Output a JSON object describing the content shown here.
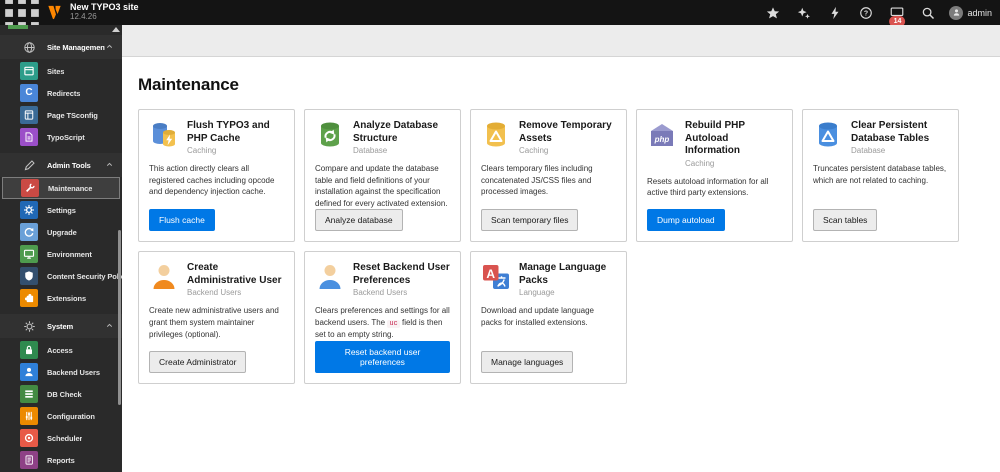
{
  "colors": {
    "primary_button": "#0078e6",
    "badge": "#d9534f",
    "topbar_bg": "#141414",
    "sidebar_bg": "#2a2a2a",
    "scrolled_module_sliver": "#4e9b4e"
  },
  "topbar": {
    "site_title": "New TYPO3 site",
    "version": "12.4.26",
    "badge_count": "14",
    "username": "admin",
    "icons": [
      "module-menu-toggle-icon",
      "typo3-logo",
      "bookmark-icon",
      "shortcut-icon",
      "clear-cache-icon",
      "help-icon",
      "system-information-icon",
      "search-icon",
      "avatar"
    ]
  },
  "sidebar": {
    "sections": [
      {
        "label": "Site Management",
        "icon": "globe-icon",
        "items": [
          {
            "label": "Sites",
            "icon": "sites-icon",
            "icon_color": "#2d9d8a"
          },
          {
            "label": "Redirects",
            "icon": "redirects-icon",
            "icon_color": "#4a86d8",
            "glyph": "C"
          },
          {
            "label": "Page TSconfig",
            "icon": "page-tsconfig-icon",
            "icon_color": "#3a6a96"
          },
          {
            "label": "TypoScript",
            "icon": "typoscript-icon",
            "icon_color": "#9b4fc8"
          }
        ]
      },
      {
        "label": "Admin Tools",
        "icon": "tools-icon",
        "items": [
          {
            "label": "Maintenance",
            "icon": "wrench-icon",
            "icon_color": "#ca4a44",
            "active": true
          },
          {
            "label": "Settings",
            "icon": "gear-icon",
            "icon_color": "#2068b5"
          },
          {
            "label": "Upgrade",
            "icon": "refresh-icon",
            "icon_color": "#6aa0d8"
          },
          {
            "label": "Environment",
            "icon": "monitor-icon",
            "icon_color": "#4e9b4e"
          },
          {
            "label": "Content Security Policy",
            "icon": "shield-icon",
            "icon_color": "#334f6e"
          },
          {
            "label": "Extensions",
            "icon": "puzzle-icon",
            "icon_color": "#ec8a00"
          }
        ]
      },
      {
        "label": "System",
        "icon": "gear-icon",
        "items": [
          {
            "label": "Access",
            "icon": "lock-icon",
            "icon_color": "#2f8a4f"
          },
          {
            "label": "Backend Users",
            "icon": "user-icon",
            "icon_color": "#2f80d9"
          },
          {
            "label": "DB Check",
            "icon": "db-icon",
            "icon_color": "#438a43"
          },
          {
            "label": "Configuration",
            "icon": "sliders-icon",
            "icon_color": "#ec8a00"
          },
          {
            "label": "Scheduler",
            "icon": "target-icon",
            "icon_color": "#e85a47"
          },
          {
            "label": "Reports",
            "icon": "report-icon",
            "icon_color": "#8e4186"
          }
        ]
      }
    ]
  },
  "main": {
    "page_title": "Maintenance",
    "cards": [
      {
        "title": "Flush TYPO3 and PHP Cache",
        "category": "Caching",
        "description": "This action directly clears all registered caches including opcode and dependency injection cache.",
        "button": "Flush cache",
        "button_style": "primary"
      },
      {
        "title": "Analyze Database Structure",
        "category": "Database",
        "description": "Compare and update the database table and field definitions of your installation against the specification defined for every activated extension.",
        "button": "Analyze database",
        "button_style": "default"
      },
      {
        "title": "Remove Temporary Assets",
        "category": "Caching",
        "description": "Clears temporary files including concatenated JS/CSS files and processed images.",
        "button": "Scan temporary files",
        "button_style": "default"
      },
      {
        "title": "Rebuild PHP Autoload Information",
        "category": "Caching",
        "description": "Resets autoload information for all active third party extensions.",
        "button": "Dump autoload",
        "button_style": "primary",
        "icon_text": "php"
      },
      {
        "title": "Clear Persistent Database Tables",
        "category": "Database",
        "description": "Truncates persistent database tables, which are not related to caching.",
        "button": "Scan tables",
        "button_style": "default"
      },
      {
        "title": "Create Administrative User",
        "category": "Backend Users",
        "description": "Create new administrative users and grant them system maintainer privileges (optional).",
        "button": "Create Administrator",
        "button_style": "default"
      },
      {
        "title": "Reset Backend User Preferences",
        "category": "Backend Users",
        "description_before": "Clears preferences and settings for all backend users. The ",
        "code": "uc",
        "description_after": " field is then set to an empty string.",
        "button": "Reset backend user preferences",
        "button_style": "primary"
      },
      {
        "title": "Manage Language Packs",
        "category": "Language",
        "description": "Download and update language packs for installed extensions.",
        "button": "Manage languages",
        "button_style": "default",
        "icon_text": "A"
      }
    ]
  }
}
